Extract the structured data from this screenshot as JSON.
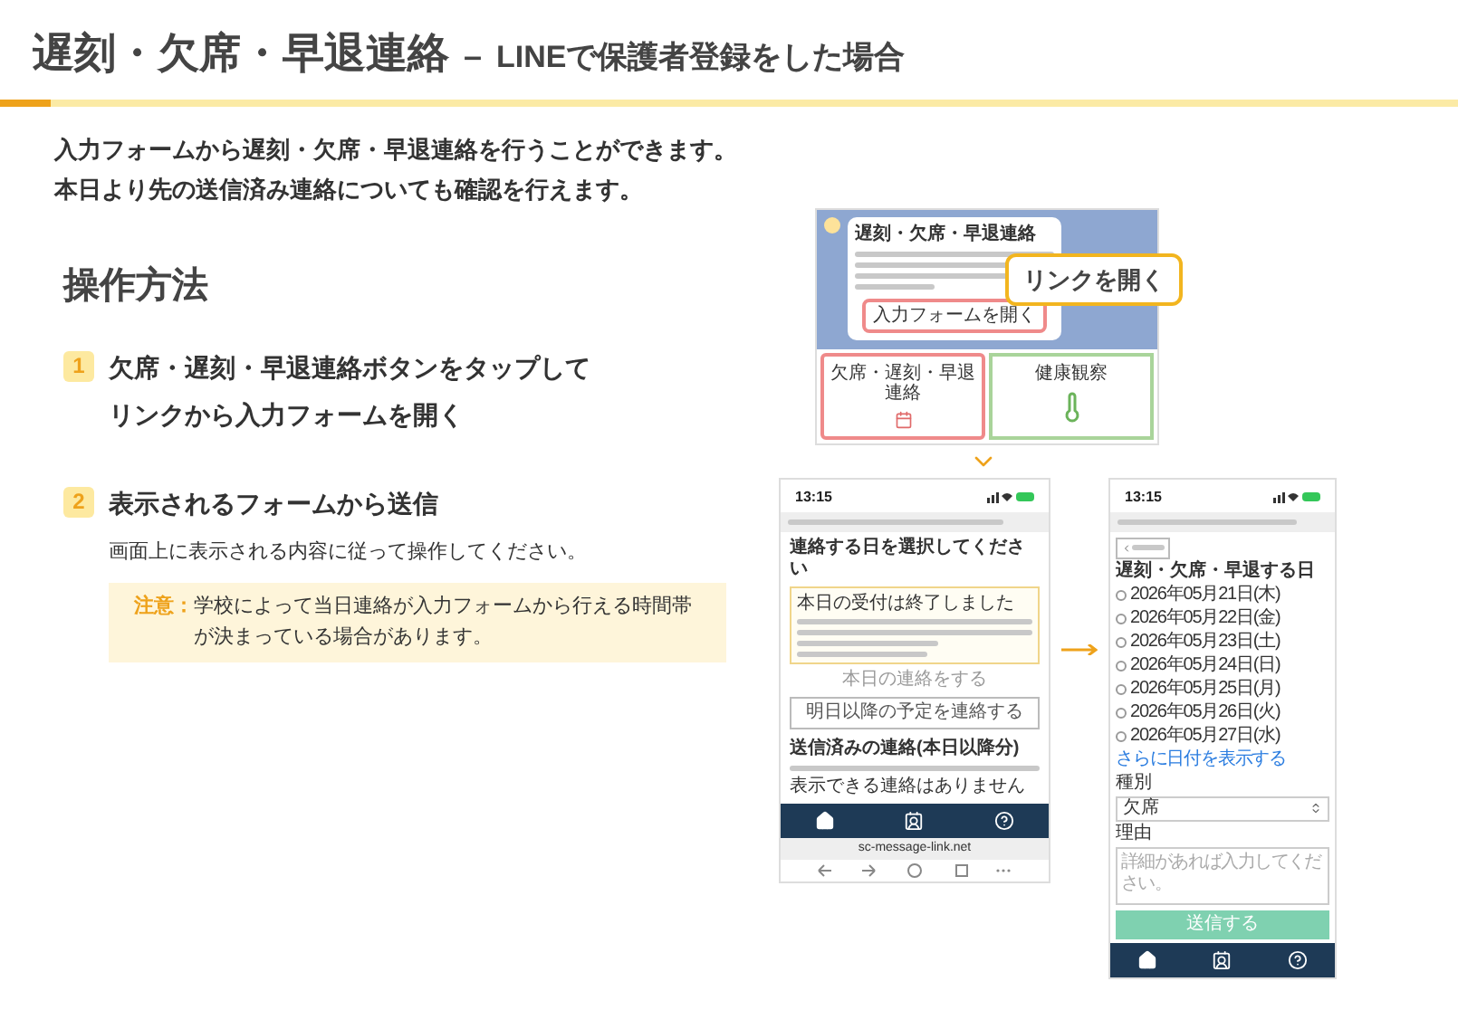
{
  "title": {
    "main": "遅刻・欠席・早退連絡",
    "separator": "–",
    "sub": "LINEで保護者登録をした場合"
  },
  "intro": [
    "入力フォームから遅刻・欠席・早退連絡を行うことができます。",
    "本日より先の送信済み連絡についても確認を行えます。"
  ],
  "section": {
    "heading": "操作方法",
    "steps": [
      {
        "number": "1",
        "lines": [
          "欠席・遅刻・早退連絡ボタンをタップして",
          "リンクから入力フォームを開く"
        ]
      },
      {
        "number": "2",
        "lines": [
          "表示されるフォームから送信"
        ],
        "description": "画面上に表示される内容に従って操作してください。",
        "note": {
          "label": "注意：",
          "text": "学校によって当日連絡が入力フォームから行える時間帯が決まっている場合があります。"
        }
      }
    ]
  },
  "line_screen": {
    "message_title": "遅刻・欠席・早退連絡",
    "link": "入力フォームを開く",
    "callout": "リンクを開く",
    "tiles": [
      {
        "label": "欠席・遅刻・早退連絡",
        "kind": "calendar",
        "highlighted": true
      },
      {
        "label": "健康観察",
        "kind": "thermometer",
        "highlighted": false
      }
    ]
  },
  "form_screen": {
    "time": "13:15",
    "heading": "連絡する日を選択してください",
    "notice_title": "本日の受付は終了しました",
    "today_button": {
      "label": "本日の連絡をする",
      "disabled": true
    },
    "future_button": "明日以降の予定を連絡する",
    "sent_heading": "送信済みの連絡(本日以降分)",
    "empty": "表示できる連絡はありません",
    "url": "sc-message-link.net"
  },
  "date_screen": {
    "time": "13:15",
    "heading": "遅刻・欠席・早退する日",
    "dates": [
      {
        "label": "2026年05月21日(木)",
        "selected": false
      },
      {
        "label": "2026年05月22日(金)",
        "selected": false
      },
      {
        "label": "2026年05月23日(土)",
        "selected": false
      },
      {
        "label": "2026年05月24日(日)",
        "selected": false
      },
      {
        "label": "2026年05月25日(月)",
        "selected": false
      },
      {
        "label": "2026年05月26日(火)",
        "selected": false
      },
      {
        "label": "2026年05月27日(水)",
        "selected": false
      }
    ],
    "more": "さらに日付を表示する",
    "type_label": "種別",
    "type_value": "欠席",
    "reason_label": "理由",
    "reason_placeholder": "詳細があれば入力してください。",
    "submit": "送信する"
  }
}
